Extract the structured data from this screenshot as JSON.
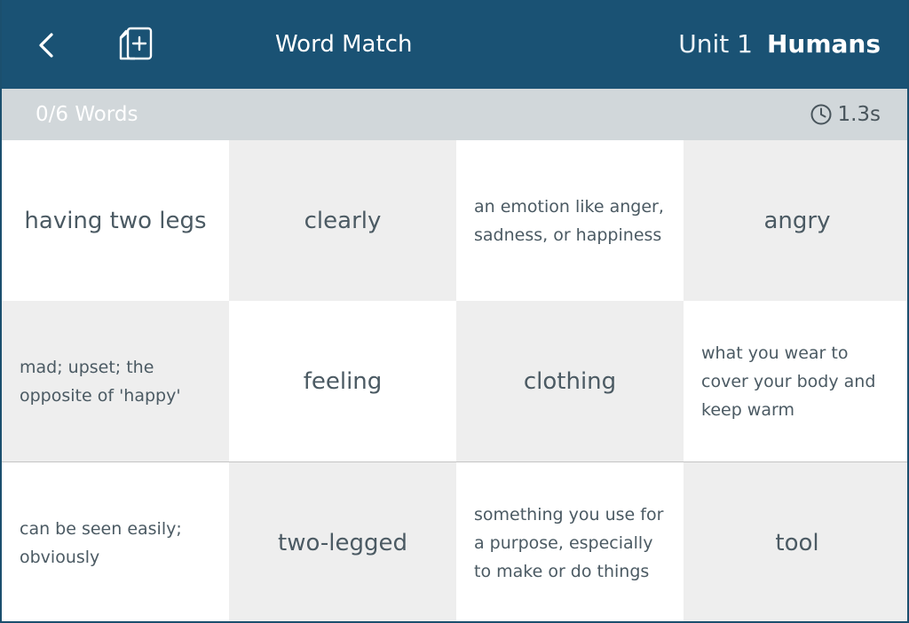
{
  "header": {
    "title": "Word Match",
    "unit": "Unit 1",
    "topic": "Humans",
    "back_icon": "back-arrow-icon",
    "deck_icon": "add-card-icon"
  },
  "status": {
    "progress": "0/6 Words",
    "timer": "1.3s",
    "timer_icon": "clock-icon"
  },
  "tiles": [
    {
      "text": "having two legs",
      "kind": "word"
    },
    {
      "text": "clearly",
      "kind": "word"
    },
    {
      "text": "an emotion like anger, sadness, or happiness",
      "kind": "definition"
    },
    {
      "text": "angry",
      "kind": "word"
    },
    {
      "text": "mad; upset; the opposite of 'happy'",
      "kind": "definition"
    },
    {
      "text": "feeling",
      "kind": "word"
    },
    {
      "text": "clothing",
      "kind": "word"
    },
    {
      "text": "what you wear to cover your body and keep warm",
      "kind": "definition"
    },
    {
      "text": "can be seen easily; obviously",
      "kind": "definition"
    },
    {
      "text": "two-legged",
      "kind": "word"
    },
    {
      "text": "something you use for a purpose, especially to make or do things",
      "kind": "definition"
    },
    {
      "text": "tool",
      "kind": "word"
    }
  ],
  "colors": {
    "header_bg": "#1a5274",
    "status_bg": "#d1d7da",
    "tile_shade": "#eeeeee",
    "tile_light": "#ffffff",
    "text": "#4b5a63"
  }
}
